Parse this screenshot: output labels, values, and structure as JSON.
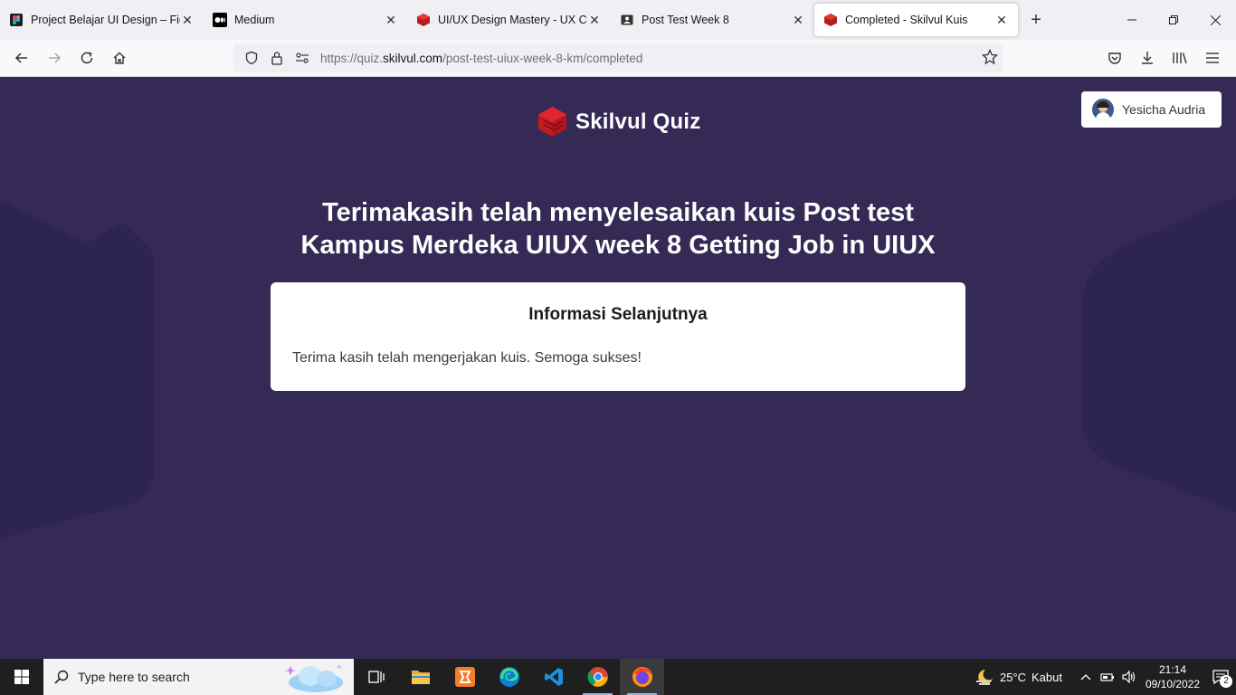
{
  "browser": {
    "tabs": [
      {
        "title": "Project Belajar UI Design – Figm",
        "icon": "figma-icon",
        "active": false
      },
      {
        "title": "Medium",
        "icon": "medium-icon",
        "active": false
      },
      {
        "title": "UI/UX Design Mastery - UX Case",
        "icon": "skilvul-icon",
        "active": false
      },
      {
        "title": "Post Test Week 8",
        "icon": "user-card-icon",
        "active": false
      },
      {
        "title": "Completed - Skilvul Kuis",
        "icon": "skilvul-icon",
        "active": true
      }
    ],
    "close_glyph": "✕",
    "new_tab_glyph": "+",
    "url_prefix": "https://quiz.",
    "url_host": "skilvul.com",
    "url_path": "/post-test-uiux-week-8-km/completed"
  },
  "page": {
    "brand": "Skilvul Quiz",
    "user_name": "Yesicha Audria",
    "headline_line1": "Terimakasih telah menyelesaikan kuis Post test",
    "headline_line2": "Kampus Merdeka UIUX week 8 Getting Job in UIUX",
    "card_title": "Informasi Selanjutnya",
    "card_body": "Terima kasih telah mengerjakan kuis. Semoga sukses!",
    "background_color": "#352a55",
    "brand_color": "#e0262f"
  },
  "taskbar": {
    "search_placeholder": "Type here to search",
    "weather_temp": "25°C",
    "weather_desc": "Kabut",
    "time": "21:14",
    "date": "09/10/2022",
    "notification_count": "2"
  }
}
